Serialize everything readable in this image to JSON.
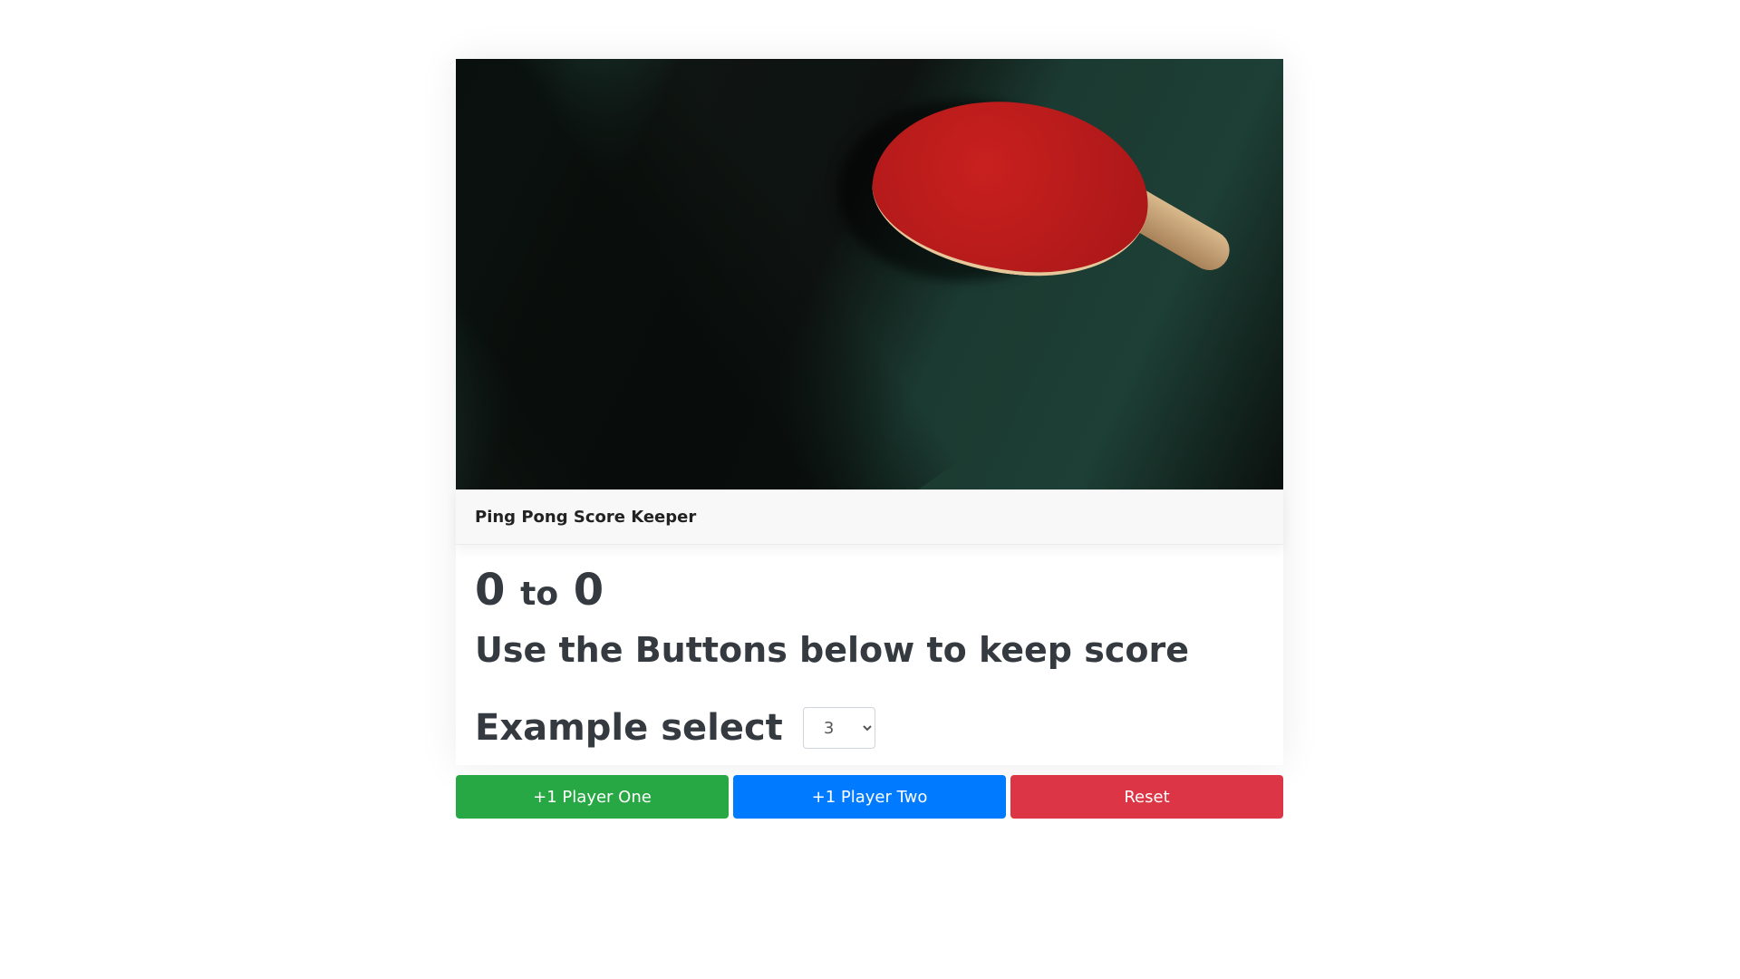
{
  "card": {
    "title": "Ping Pong Score Keeper",
    "image_alt": "ping pong paddle on table"
  },
  "score": {
    "player_one": "0",
    "separator": "to",
    "player_two": "0"
  },
  "instructions": "Use the Buttons below to keep score",
  "select": {
    "label": "Example select",
    "value": "3"
  },
  "buttons": [
    {
      "label": "+1 Player One",
      "color": "#28a745"
    },
    {
      "label": "+1 Player Two",
      "color": "#007bff"
    },
    {
      "label": "Reset",
      "color": "#dc3545"
    }
  ]
}
